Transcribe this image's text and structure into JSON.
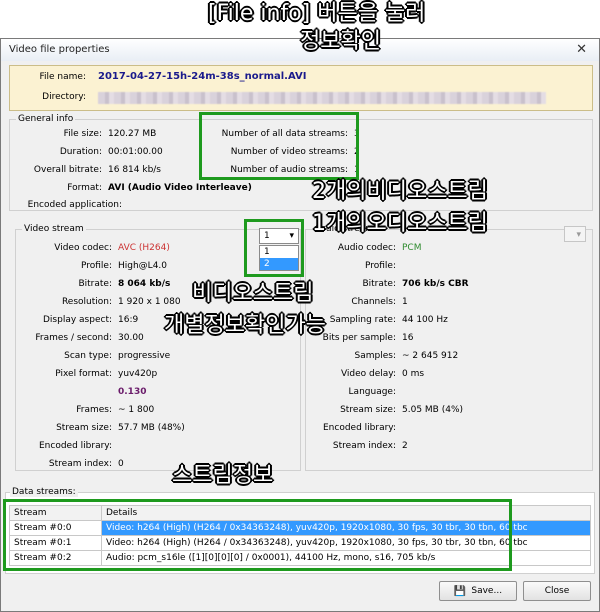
{
  "annotations": {
    "top_line1": "[File info] 버튼을 눌러",
    "top_line2": "정보확인",
    "streams_line1": "2개의비디오스트림",
    "streams_line2": "1개의오디오스트림",
    "video_line1": "비디오스트림",
    "video_line2": "개별정보확인가능",
    "stream_info": "스트림정보"
  },
  "window": {
    "title": "Video file properties",
    "close": "✕"
  },
  "file": {
    "name_label": "File name:",
    "name_value": "2017-04-27-15h-24m-38s_normal.AVI",
    "dir_label": "Directory:"
  },
  "general": {
    "title": "General info",
    "rows": [
      {
        "label": "File size:",
        "value": "120.27 MB"
      },
      {
        "label": "Duration:",
        "value": "00:01:00.00"
      },
      {
        "label": "Overall bitrate:",
        "value": "16 814 kb/s"
      },
      {
        "label": "Format:",
        "value": "AVI (Audio Video Interleave)"
      },
      {
        "label": "Encoded application:",
        "value": ""
      }
    ],
    "counts": [
      {
        "label": "Number of all data streams:",
        "value": "3"
      },
      {
        "label": "Number of video streams:",
        "value": "2"
      },
      {
        "label": "Number of audio streams:",
        "value": "1"
      }
    ]
  },
  "video": {
    "title": "Video stream",
    "selector": {
      "value": "1",
      "options": [
        "1",
        "2"
      ]
    },
    "rows": [
      {
        "label": "Video codec:",
        "value": "AVC (H264)"
      },
      {
        "label": "Profile:",
        "value": "High@L4.0"
      },
      {
        "label": "Bitrate:",
        "value": "8 064 kb/s"
      },
      {
        "label": "Resolution:",
        "value": "1 920 x 1 080"
      },
      {
        "label": "Display aspect:",
        "value": "16:9"
      },
      {
        "label": "Frames / second:",
        "value": "30.00"
      },
      {
        "label": "Scan type:",
        "value": "progressive"
      },
      {
        "label": "Pixel format:",
        "value": "yuv420p"
      },
      {
        "label": "",
        "value": "0.130"
      },
      {
        "label": "Frames:",
        "value": "~ 1 800"
      },
      {
        "label": "Stream size:",
        "value": "57.7 MB (48%)"
      },
      {
        "label": "Encoded library:",
        "value": ""
      },
      {
        "label": "Stream index:",
        "value": "0"
      }
    ]
  },
  "audio": {
    "title": "Audio stream",
    "rows": [
      {
        "label": "Audio codec:",
        "value": "PCM"
      },
      {
        "label": "Profile:",
        "value": ""
      },
      {
        "label": "Bitrate:",
        "value": "706 kb/s  CBR"
      },
      {
        "label": "Channels:",
        "value": "1"
      },
      {
        "label": "Sampling rate:",
        "value": "44 100 Hz"
      },
      {
        "label": "Bits per sample:",
        "value": "16"
      },
      {
        "label": "Samples:",
        "value": "~ 2 645 912"
      },
      {
        "label": "Video delay:",
        "value": "0 ms"
      },
      {
        "label": "Language:",
        "value": ""
      },
      {
        "label": "Stream size:",
        "value": "5.05 MB (4%)"
      },
      {
        "label": "Encoded library:",
        "value": ""
      },
      {
        "label": "Stream index:",
        "value": "2"
      }
    ]
  },
  "data_streams": {
    "title": "Data streams:",
    "headers": [
      "Stream",
      "Details"
    ],
    "rows": [
      {
        "stream": "Stream #0:0",
        "details": "Video: h264 (High) (H264 / 0x34363248), yuv420p, 1920x1080, 30 fps, 30 tbr, 30 tbn, 60 tbc"
      },
      {
        "stream": "Stream #0:1",
        "details": "Video: h264 (High) (H264 / 0x34363248), yuv420p, 1920x1080, 30 fps, 30 tbr, 30 tbn, 60 tbc"
      },
      {
        "stream": "Stream #0:2",
        "details": "Audio: pcm_s16le ([1][0][0][0] / 0x0001), 44100 Hz, mono, s16, 705 kb/s"
      }
    ]
  },
  "buttons": {
    "save": "Save...",
    "close": "Close"
  },
  "colors": {
    "annotation_box": "#1e9a1e",
    "selected_row": "#3399ff",
    "codec_red": "#cc3333",
    "codec_green": "#2e8b2e",
    "filename": "#1a1a8c"
  }
}
